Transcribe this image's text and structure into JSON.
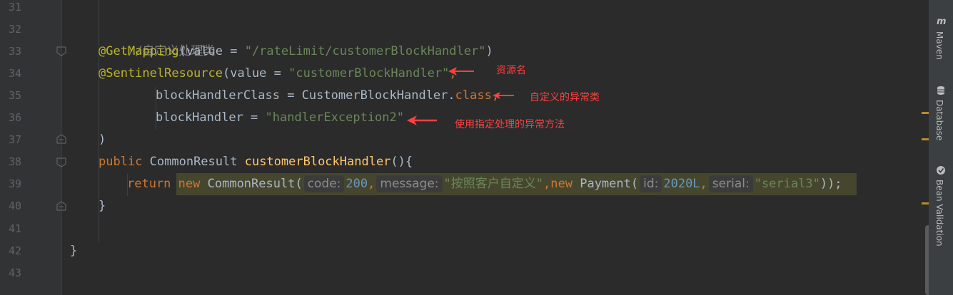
{
  "editor": {
    "line_numbers": [
      "31",
      "32",
      "33",
      "34",
      "35",
      "36",
      "37",
      "38",
      "39",
      "40",
      "41",
      "42",
      "43"
    ],
    "code": {
      "l32": {
        "comment": "//自定义处理类"
      },
      "l33": {
        "annotation": "@GetMapping",
        "open": "(value = ",
        "string": "\"/rateLimit/customerBlockHandler\"",
        "close": ")"
      },
      "l34": {
        "annotation": "@SentinelResource",
        "open": "(value = ",
        "string": "\"customerBlockHandler\"",
        "comma": ","
      },
      "l35": {
        "text": "blockHandlerClass = CustomerBlockHandler.",
        "keyword": "class",
        "comma": ","
      },
      "l36": {
        "text": "blockHandler = ",
        "string": "\"handlerException2\""
      },
      "l37": {
        "text": ")"
      },
      "l38": {
        "keyword": "public",
        "type": " CommonResult ",
        "method": "customerBlockHandler",
        "tail": "(){"
      },
      "l39": {
        "kw_return": "return",
        "kw_new": "new",
        "class1": " CommonResult(",
        "hint_code": "code:",
        "num_code": "200",
        "comma1": ",",
        "hint_message": "message:",
        "str_message": "\"按照客户自定义\"",
        "comma2": ",",
        "kw_new2": "new",
        "class2": " Payment(",
        "hint_id": "id:",
        "num_id": "2020L",
        "comma3": ",",
        "hint_serial": "serial:",
        "str_serial": "\"serial3\"",
        "close": "));"
      },
      "l40": {
        "text": "}"
      },
      "l42": {
        "text": "}"
      }
    }
  },
  "annotations": {
    "resource_name": "资源名",
    "custom_exception_class": "自定义的异常类",
    "use_handler": "使用指定处理的异常方法",
    "color": "#ff4040"
  },
  "tool_windows": {
    "maven": {
      "label": "Maven",
      "icon": "maven-m-icon"
    },
    "database": {
      "label": "Database",
      "icon": "database-icon"
    },
    "bean_validation": {
      "label": "Bean Validation",
      "icon": "bean-validation-icon"
    }
  },
  "colors": {
    "background": "#2b2b2b",
    "keyword": "#cc7832",
    "string": "#6a8759",
    "annotation": "#bbb529",
    "method": "#ffc66d",
    "number": "#6897bb",
    "comment": "#808080",
    "highlight": "#46462f"
  }
}
